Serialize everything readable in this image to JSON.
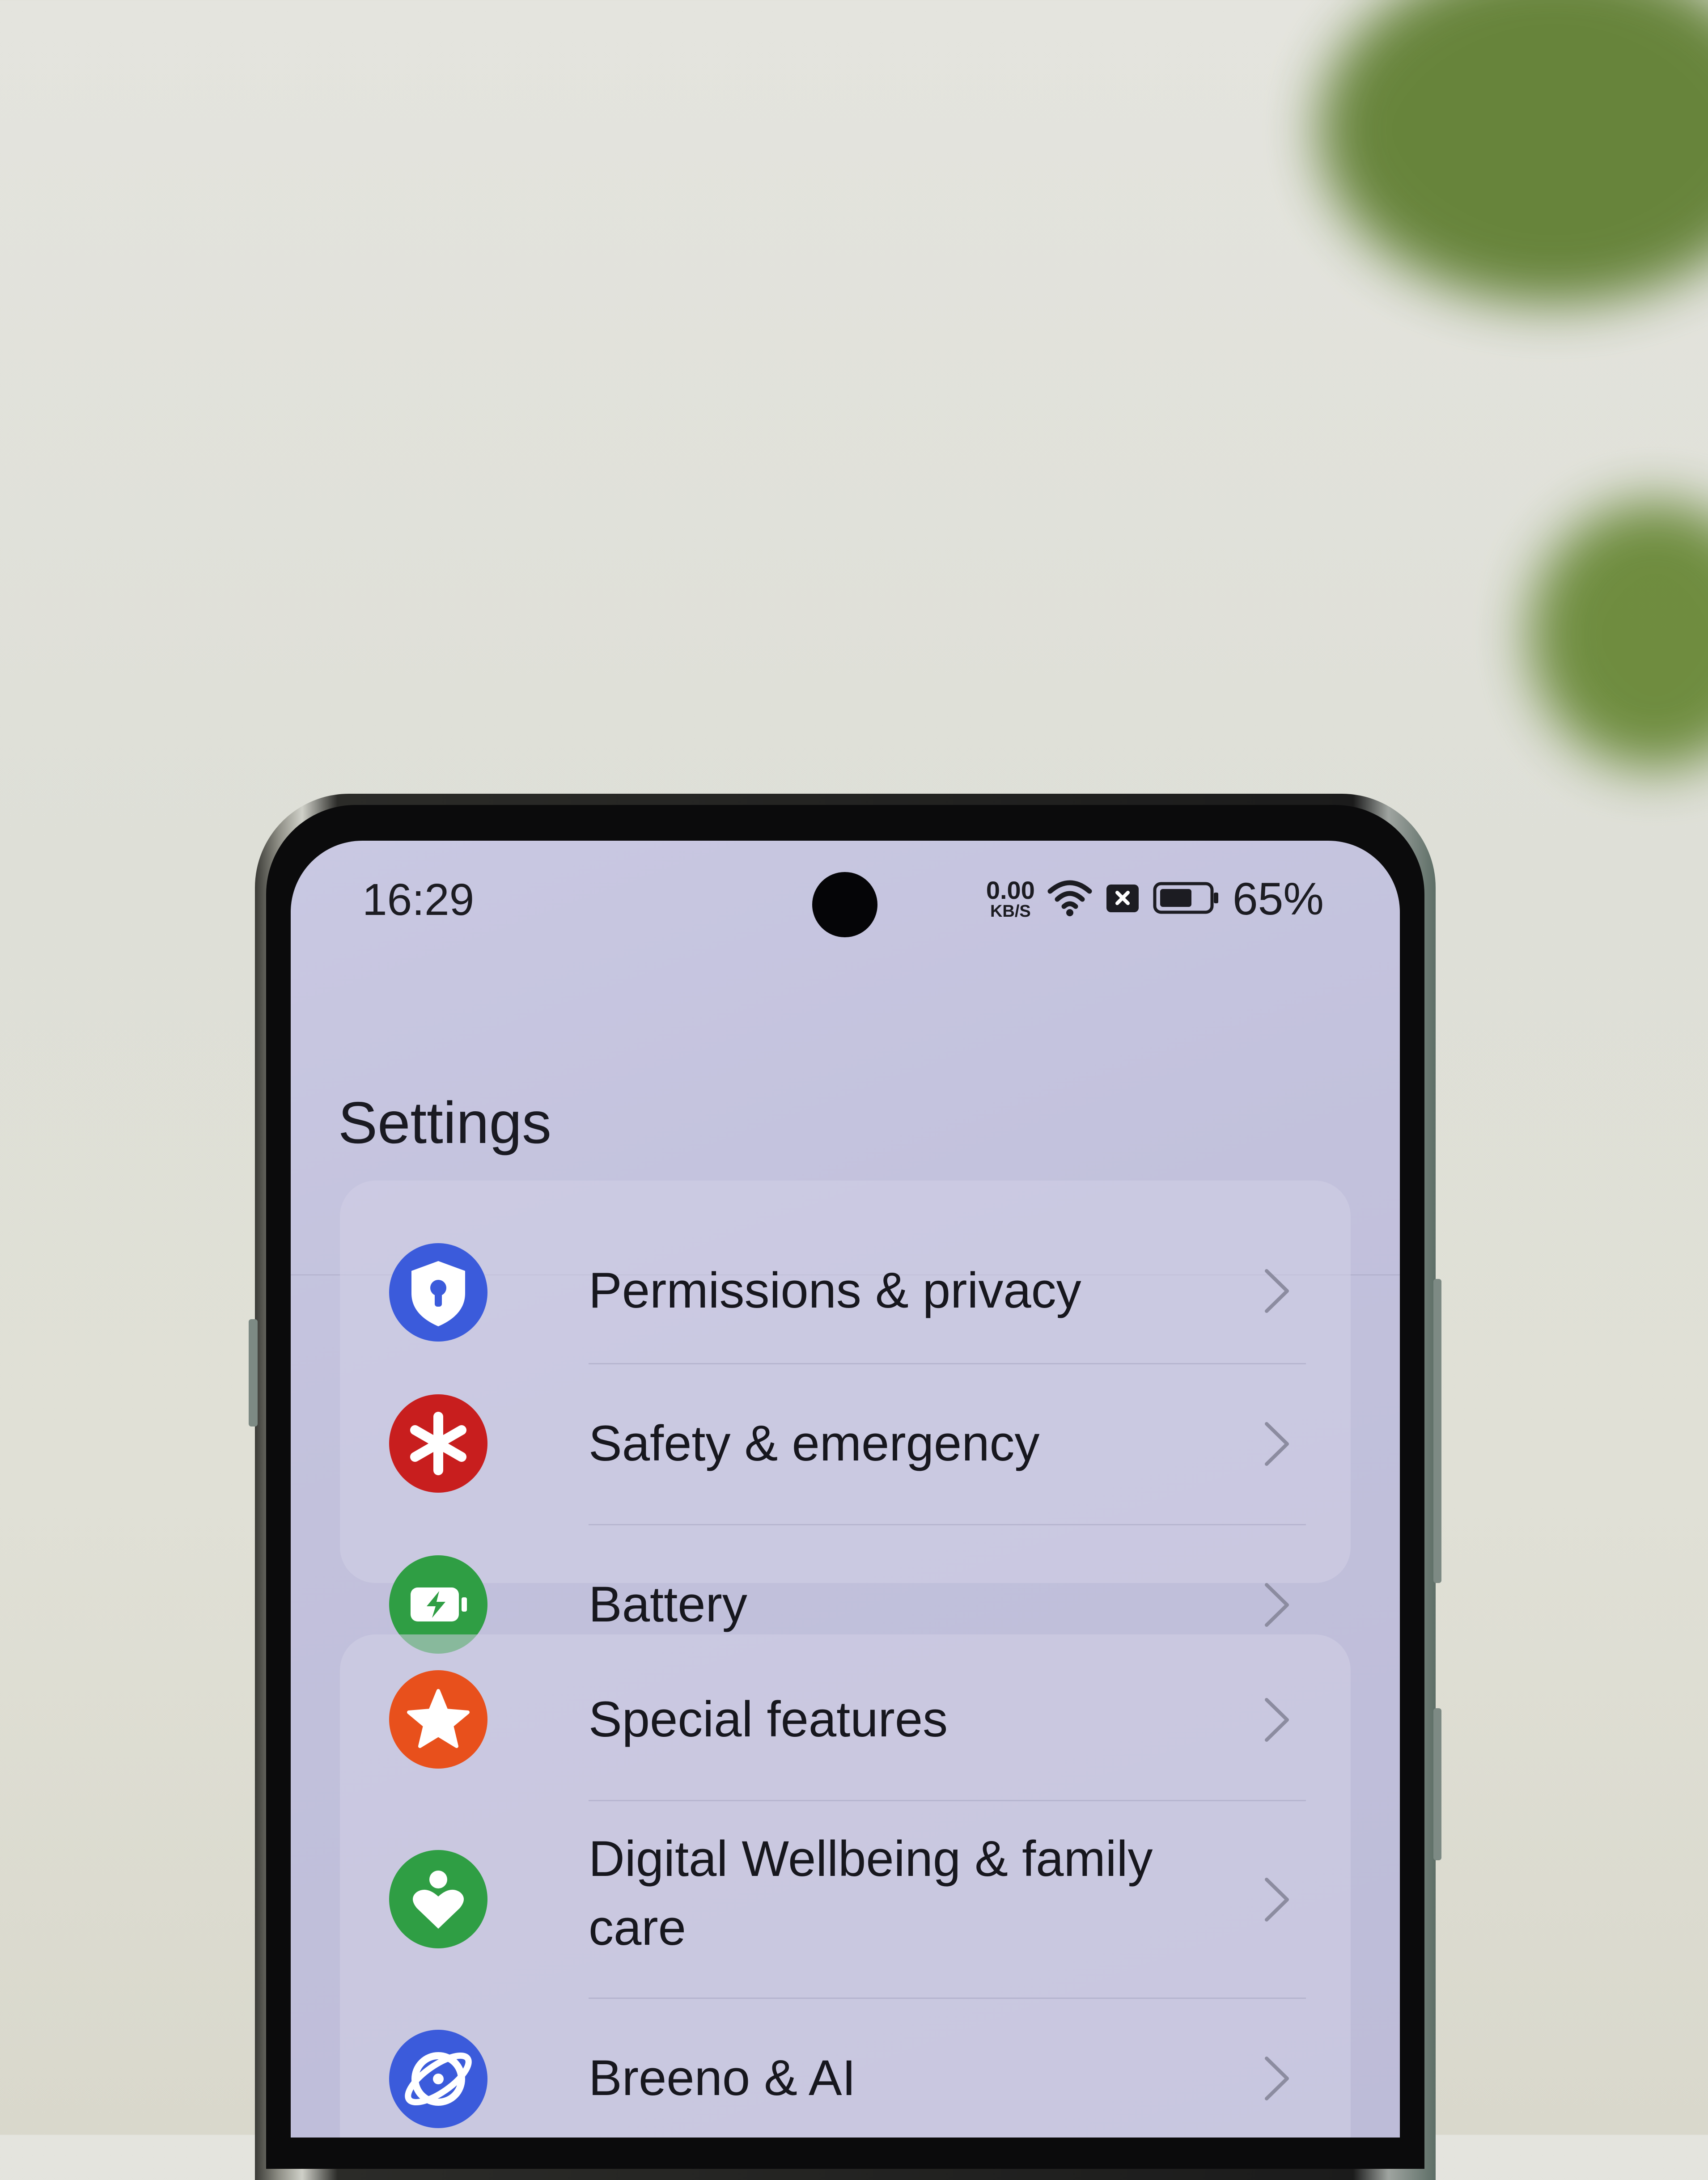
{
  "status_bar": {
    "time": "16:29",
    "net_speed_value": "0.00",
    "net_speed_unit": "KB/S",
    "battery_percent": "65%",
    "icons": [
      "wifi-icon",
      "no-sim-icon",
      "battery-icon"
    ]
  },
  "header": {
    "title": "Settings"
  },
  "groups": [
    {
      "items": [
        {
          "label": "Permissions & privacy",
          "icon": "shield-lock-icon",
          "color": "#3b5bdb"
        },
        {
          "label": "Safety & emergency",
          "icon": "asterisk-icon",
          "color": "#c81e1e"
        },
        {
          "label": "Battery",
          "icon": "battery-charging-icon",
          "color": "#2f9e44"
        }
      ]
    },
    {
      "items": [
        {
          "label": "Special features",
          "icon": "star-icon",
          "color": "#e8501c"
        },
        {
          "label_line1": "Digital Wellbeing & family",
          "label_line2": "care",
          "icon": "heart-person-icon",
          "color": "#2f9e44"
        },
        {
          "label": "Breeno & AI",
          "icon": "breeno-icon",
          "color": "#3b5bdb"
        }
      ]
    }
  ]
}
